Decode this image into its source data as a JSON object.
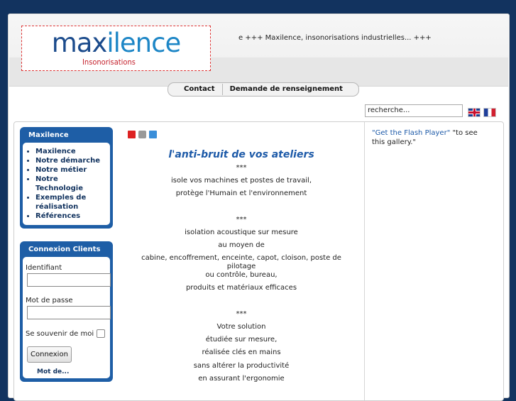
{
  "header": {
    "logo_main_1": "max",
    "logo_main_2": "ilence",
    "logo_sub": "Insonorisations",
    "marquee": "e +++ Maxilence, insonorisations industrielles... +++"
  },
  "nav": {
    "contact": "Contact",
    "demande": "Demande de renseignement"
  },
  "search": {
    "value": "recherche..."
  },
  "sidebar": {
    "menu_title": "Maxilence",
    "menu_items": [
      "Maxilence",
      "Notre démarche",
      "Notre métier",
      "Notre Technologie",
      "Exemples de réalisation",
      "Références"
    ],
    "login_title": "Connexion Clients",
    "identifiant_label": "Identifiant",
    "password_label": "Mot de passe",
    "remember_label": "Se souvenir de moi",
    "login_button": "Connexion",
    "lost_password": "Mot de..."
  },
  "main": {
    "title": "l'anti-bruit de vos ateliers",
    "lines": [
      "***",
      "isole vos machines et postes de travail,",
      "protège l'Humain et l'environnement",
      "",
      "***",
      "isolation acoustique sur mesure",
      "au moyen de",
      "cabine, encoffrement, enceinte, capot, cloison, poste de pilotage",
      "ou contrôle, bureau,",
      "produits et matériaux efficaces",
      "",
      "***",
      "Votre solution",
      "étudiée sur mesure,",
      "réalisée clés en mains",
      "sans altérer la productivité",
      "en assurant l'ergonomie"
    ]
  },
  "right": {
    "flash_link": "\"Get the Flash Player\"",
    "flash_text": " \"to see this gallery.\""
  }
}
